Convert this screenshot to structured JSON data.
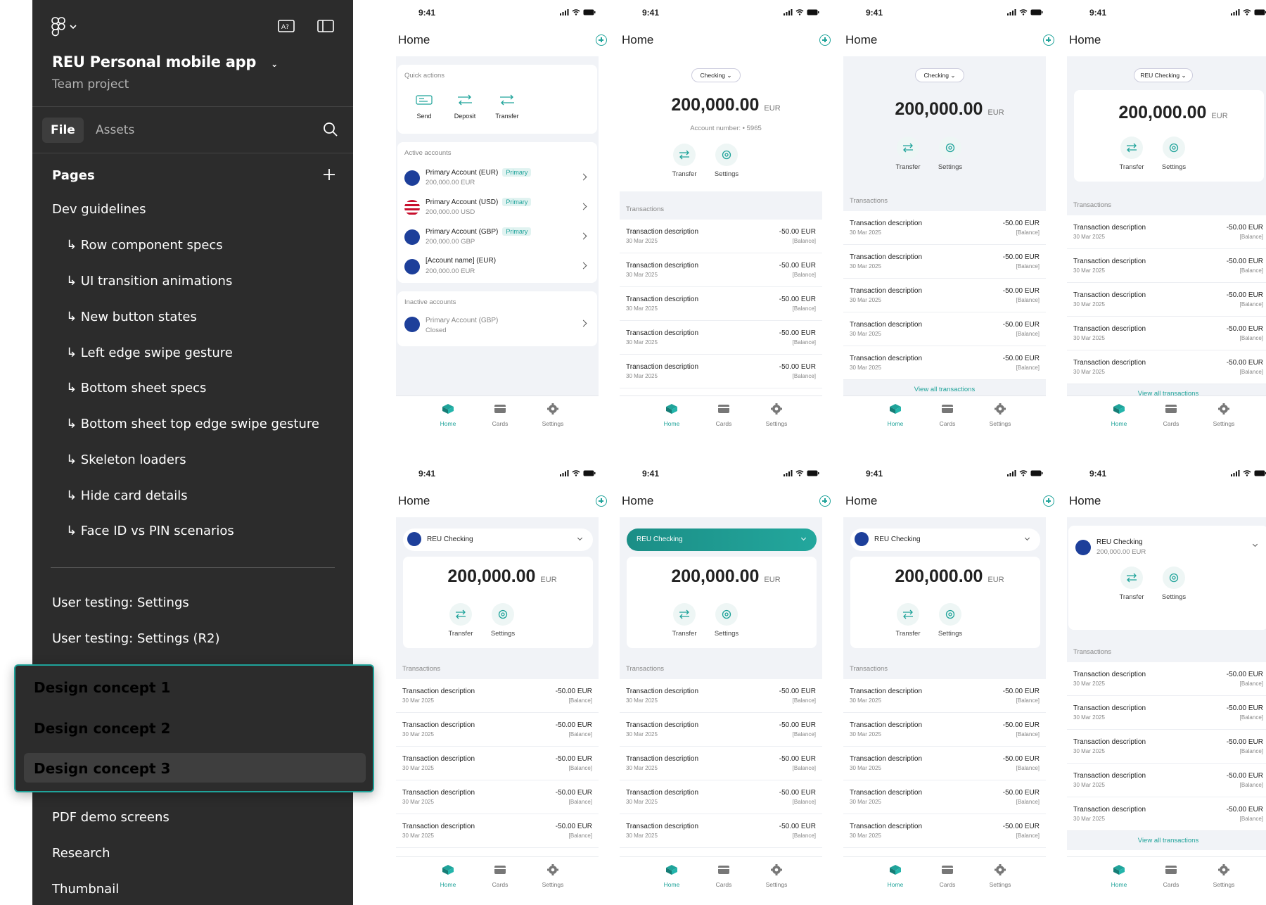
{
  "sidebar": {
    "project_title": "REU Personal mobile app",
    "project_subtitle": "Team project",
    "tabs": {
      "file": "File",
      "assets": "Assets"
    },
    "pages_header": "Pages",
    "pages": [
      "Dev guidelines",
      "↳ Row component specs",
      "↳ UI transition animations",
      "↳ New button states",
      "↳ Left edge swipe gesture",
      "↳ Bottom sheet specs",
      "↳ Bottom sheet top edge swipe gesture",
      "↳ Skeleton loaders",
      "↳ Hide card details",
      "↳ Face ID vs PIN scenarios"
    ],
    "pages_after": [
      "User testing: Settings",
      "User testing: Settings (R2)"
    ],
    "popup_items": [
      "Design concept 1",
      "Design concept 2",
      "Design concept 3"
    ],
    "pages_bottom": [
      "PDF demo screens",
      "Research",
      "Thumbnail"
    ]
  },
  "phone": {
    "time": "9:41",
    "header": "Home",
    "nav": [
      "Home",
      "Cards",
      "Settings"
    ],
    "transactions_label": "Transactions",
    "tx_desc": "Transaction description",
    "tx_date": "30 Mar 2025",
    "tx_amount": "-50.00 EUR",
    "tx_balance": "[Balance]",
    "balance": "200,000.00",
    "currency": "EUR",
    "transfer": "Transfer",
    "settings": "Settings",
    "view_all": "View all transactions",
    "checking": "Checking",
    "reu_checking": "REU Checking",
    "account_number": "Account number: • 5965",
    "reu_checking_balance": "200,000.00 EUR"
  },
  "screen1": {
    "quick_actions": "Quick actions",
    "actions": [
      "Send",
      "Deposit",
      "Transfer"
    ],
    "active_accounts": "Active accounts",
    "primary_badge": "Primary",
    "accounts": [
      {
        "name": "Primary Account (EUR)",
        "balance": "200,000.00 EUR"
      },
      {
        "name": "Primary Account (USD)",
        "balance": "200,000.00 USD"
      },
      {
        "name": "Primary Account (GBP)",
        "balance": "200,000.00 GBP"
      },
      {
        "name": "[Account name] (EUR)",
        "balance": "200,000.00 EUR"
      }
    ],
    "inactive_accounts": "Inactive accounts",
    "inactive": {
      "name": "Primary Account (GBP)",
      "status": "Closed"
    }
  },
  "colors": {
    "accent": "#1fa39a",
    "sidebar": "#2c2c2c",
    "bg": "#f1f3f7"
  }
}
